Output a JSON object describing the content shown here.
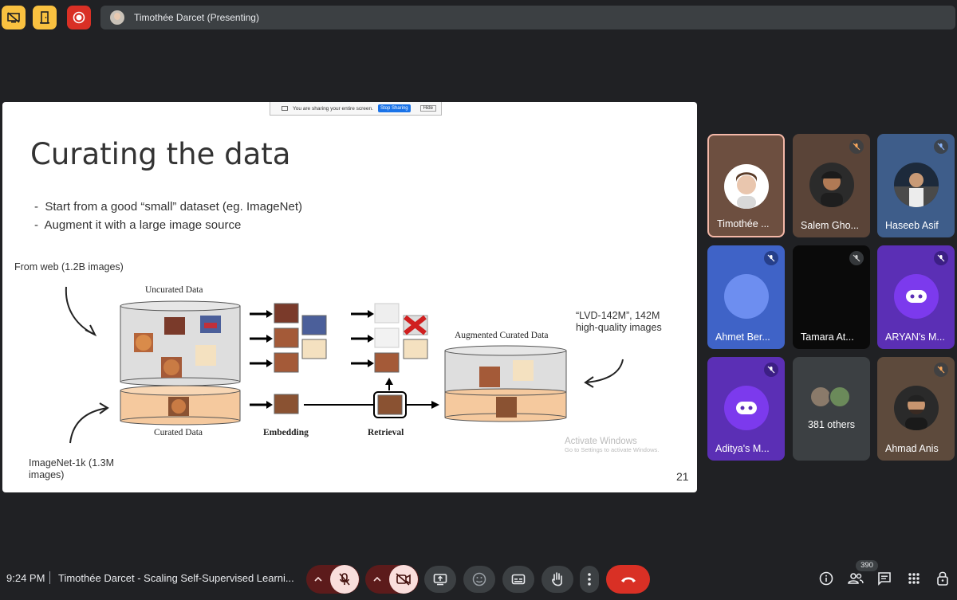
{
  "top_bar": {
    "presenter_label": "Timothée Darcet (Presenting)",
    "icons": [
      "screen-share-off-icon",
      "door-exit-icon",
      "record-icon"
    ],
    "colors": {
      "yellow": "#f9c140",
      "record_red": "#d93025"
    }
  },
  "slide": {
    "share_banner": {
      "text": "You are sharing your entire screen.",
      "stop_label": "Stop Sharing",
      "hide_label": "Hide"
    },
    "title": "Curating the data",
    "bullets": [
      "Start from a good “small” dataset (eg. ImageNet)",
      "Augment it with a large image source"
    ],
    "from_web": "From web (1.2B images)",
    "imagenet_line1": "ImageNet-1k (1.3M",
    "imagenet_line2": "images)",
    "lvd_line1": "“LVD-142M”, 142M",
    "lvd_line2": "high-quality images",
    "diagram": {
      "uncurated": "Uncurated Data",
      "curated": "Curated Data",
      "embedding": "Embedding",
      "retrieval": "Retrieval",
      "augmented": "Augmented Curated Data"
    },
    "watermark_line1": "Activate Windows",
    "watermark_line2": "Go to Settings to activate Windows.",
    "page_number": "21"
  },
  "participants": [
    {
      "name": "Timothée ...",
      "muted": false,
      "avatar": "photo",
      "color": "#6d4f40",
      "highlight": true
    },
    {
      "name": "Salem Gho...",
      "muted": true,
      "avatar": "photo",
      "color": "#5a4438"
    },
    {
      "name": "Haseeb Asif",
      "muted": true,
      "avatar": "photo",
      "color": "#3e5d8a"
    },
    {
      "name": "Ahmet Ber...",
      "muted": true,
      "avatar": "circle",
      "color": "#3f63c7"
    },
    {
      "name": "Tamara At...",
      "muted": true,
      "avatar": "none",
      "color": "#0a0a0a"
    },
    {
      "name": "ARYAN's M...",
      "muted": true,
      "avatar": "bot",
      "color": "#5b2fb5"
    },
    {
      "name": "Aditya's M...",
      "muted": true,
      "avatar": "bot",
      "color": "#5b2fb5"
    },
    {
      "name": "",
      "others": "381 others",
      "color": "#3c4043"
    },
    {
      "name": "Ahmad Anis",
      "muted": true,
      "avatar": "photo",
      "color": "#5d4a3c"
    }
  ],
  "bottom_bar": {
    "time": "9:24 PM",
    "meeting_title": "Timothée Darcet - Scaling Self-Supervised Learni...",
    "people_count": "390",
    "controls": [
      "mic-off-icon",
      "camera-off-icon",
      "present-icon",
      "emoji-icon",
      "captions-icon",
      "raise-hand-icon",
      "more-options-icon",
      "end-call-icon"
    ],
    "right_icons": [
      "info-icon",
      "people-icon",
      "chat-icon",
      "activities-icon",
      "lock-icon"
    ]
  }
}
